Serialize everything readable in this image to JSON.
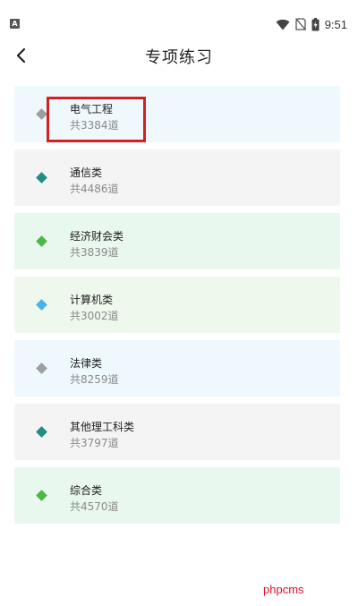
{
  "status_bar": {
    "time": "9:51",
    "left_icon": "A"
  },
  "header": {
    "title": "专项练习",
    "back_icon": "chevron-left-icon"
  },
  "categories": [
    {
      "name": "电气工程",
      "count": "共3384道",
      "bg": "#eef8fd",
      "dot": "#9e9e9e"
    },
    {
      "name": "通信类",
      "count": "共4486道",
      "bg": "#f4f4f4",
      "dot": "#1e8e86"
    },
    {
      "name": "经济财会类",
      "count": "共3839道",
      "bg": "#e9f8ee",
      "dot": "#4cb848"
    },
    {
      "name": "计算机类",
      "count": "共3002道",
      "bg": "#eff8ed",
      "dot": "#49b2e6"
    },
    {
      "name": "法律类",
      "count": "共8259道",
      "bg": "#eef8fd",
      "dot": "#9e9e9e"
    },
    {
      "name": "其他理工科类",
      "count": "共3797道",
      "bg": "#f4f4f4",
      "dot": "#1e8e86"
    },
    {
      "name": "综合类",
      "count": "共4570道",
      "bg": "#e9f8ee",
      "dot": "#4cb848"
    }
  ],
  "watermark": "phpcms"
}
